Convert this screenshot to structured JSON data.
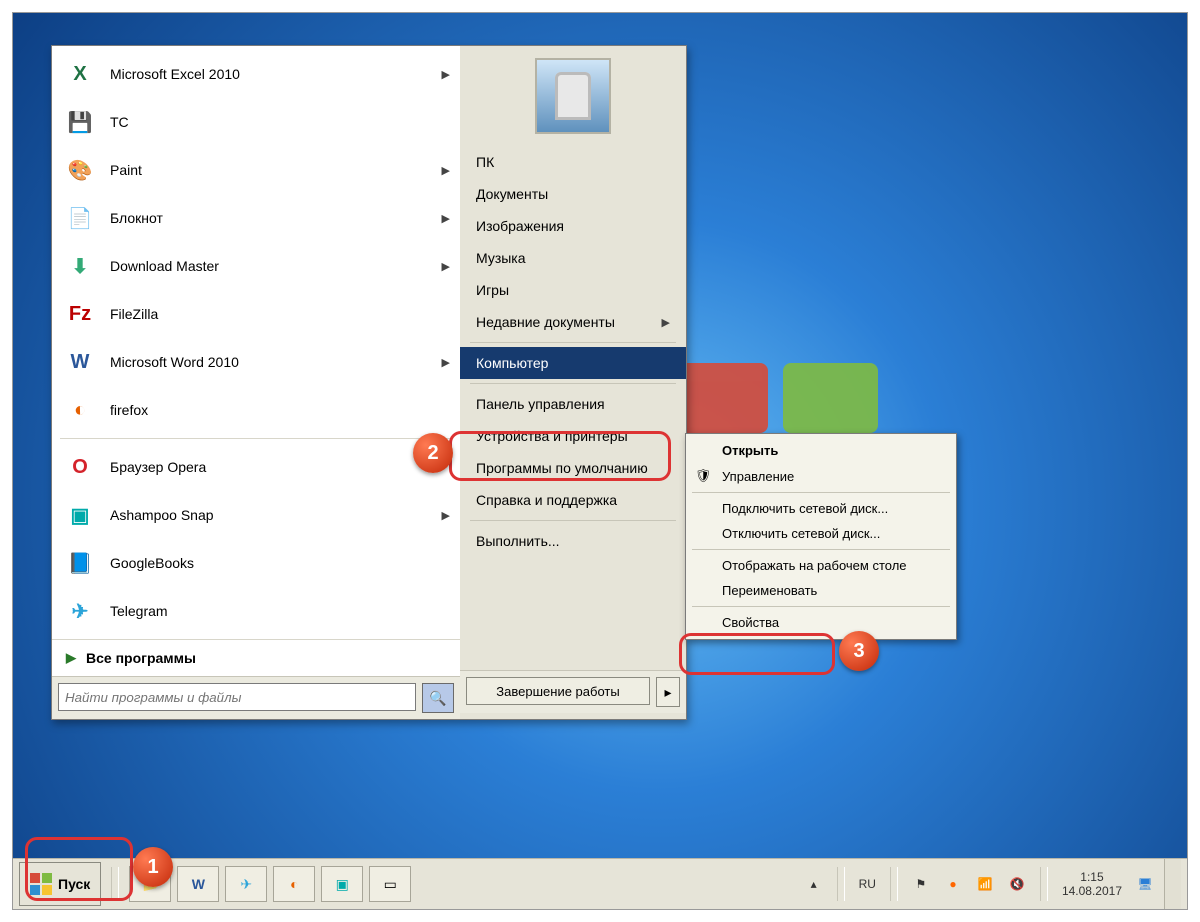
{
  "start_menu": {
    "left_items": [
      {
        "label": "Microsoft Excel 2010",
        "submenu": true,
        "icon": "excel"
      },
      {
        "label": "TC",
        "submenu": false,
        "icon": "save"
      },
      {
        "label": "Paint",
        "submenu": true,
        "icon": "paint"
      },
      {
        "label": "Блокнот",
        "submenu": true,
        "icon": "notepad"
      },
      {
        "label": "Download Master",
        "submenu": true,
        "icon": "download"
      },
      {
        "label": "FileZilla",
        "submenu": false,
        "icon": "filezilla"
      },
      {
        "label": "Microsoft Word 2010",
        "submenu": true,
        "icon": "word"
      },
      {
        "label": "firefox",
        "submenu": false,
        "icon": "firefox"
      },
      {
        "label": "Браузер Opera",
        "submenu": false,
        "icon": "opera"
      },
      {
        "label": "Ashampoo Snap",
        "submenu": true,
        "icon": "snap"
      },
      {
        "label": "GoogleBooks",
        "submenu": false,
        "icon": "books"
      },
      {
        "label": "Telegram",
        "submenu": false,
        "icon": "telegram"
      }
    ],
    "separator_after_index": 7,
    "all_programs": "Все программы",
    "search_placeholder": "Найти программы и файлы",
    "right_items": [
      {
        "label": "ПК"
      },
      {
        "label": "Документы"
      },
      {
        "label": "Изображения"
      },
      {
        "label": "Музыка"
      },
      {
        "label": "Игры"
      },
      {
        "label": "Недавние документы",
        "submenu": true,
        "sep_after": true
      },
      {
        "label": "Компьютер",
        "selected": true,
        "sep_after": true
      },
      {
        "label": "Панель управления"
      },
      {
        "label": "Устройства и принтеры"
      },
      {
        "label": "Программы по умолчанию"
      },
      {
        "label": "Справка и поддержка",
        "sep_after": true
      },
      {
        "label": "Выполнить..."
      }
    ],
    "shutdown": "Завершение работы"
  },
  "context_menu": {
    "items": [
      {
        "label": "Открыть",
        "bold": true
      },
      {
        "label": "Управление",
        "shield": true,
        "sep_after": true
      },
      {
        "label": "Подключить сетевой диск..."
      },
      {
        "label": "Отключить сетевой диск...",
        "sep_after": true
      },
      {
        "label": "Отображать на рабочем столе"
      },
      {
        "label": "Переименовать",
        "sep_after": true
      },
      {
        "label": "Свойства"
      }
    ]
  },
  "taskbar": {
    "start": "Пуск",
    "lang": "RU",
    "time": "1:15",
    "date": "14.08.2017"
  },
  "annotations": {
    "b1": "1",
    "b2": "2",
    "b3": "3"
  }
}
